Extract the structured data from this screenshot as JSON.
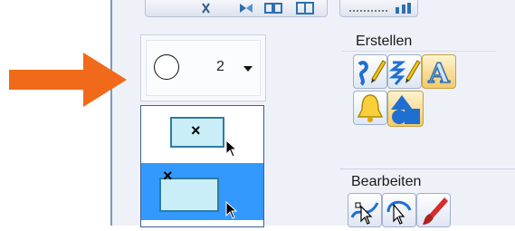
{
  "stroke_selector": {
    "value": "2"
  },
  "groups": {
    "create": {
      "title": "Erstellen"
    },
    "edit": {
      "title": "Bearbeiten"
    }
  },
  "icons": {
    "arrow": "orange-arrow-pointer",
    "create": [
      "embroidery-pen-icon",
      "zigzag-pen-icon",
      "letter-a-icon",
      "bell-icon",
      "shapes-icon"
    ],
    "edit": [
      "node-edit-icon",
      "reshape-icon",
      "paintbrush-icon"
    ]
  },
  "mode_list": {
    "items": [
      "select-inside-rectangle",
      "select-touching-rectangle"
    ],
    "selected_index": 1
  }
}
